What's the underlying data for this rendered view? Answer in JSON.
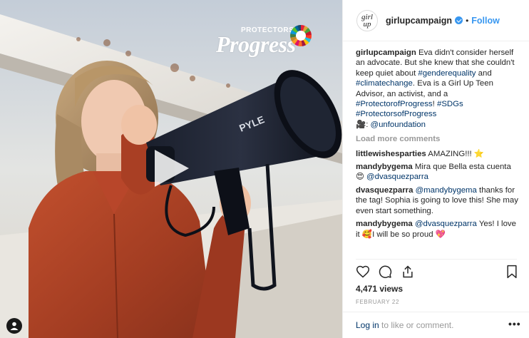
{
  "media": {
    "overlay_logo_small": "PROTECTORS",
    "overlay_logo_of": "of",
    "overlay_logo_big": "Progress",
    "megaphone_brand": "PYLE"
  },
  "post": {
    "avatar_text": "girl up",
    "username": "girlupcampaign",
    "dot": "•",
    "follow_label": "Follow"
  },
  "caption": {
    "username": "girlupcampaign",
    "text_1": " Eva didn't consider herself an advocate. But she knew that she couldn't keep quiet about ",
    "tag_1": "#genderequality",
    "text_2": " and ",
    "tag_2": "#climatechange",
    "text_3": ". Eva is a Girl Up Teen Advisor, an activist, and a ",
    "tag_3": "#ProtectorofProgress",
    "text_4": "! ",
    "tag_4": "#SDGs",
    "tag_5": "#ProtectorsofProgress",
    "credit_emoji": "🎥",
    "credit_sep": ": ",
    "credit_tag": "@unfoundation"
  },
  "load_more_label": "Load more comments",
  "comments": [
    {
      "username": "littlewishesparties",
      "text": " AMAZING!!! ",
      "emoji": "⭐"
    },
    {
      "username": "mandybygema",
      "text": " Mira que Bella esta cuenta",
      "emoji": "😍",
      "mention": "@dvasquezparra"
    },
    {
      "username": "dvasquezparra",
      "mention": "@mandybygema",
      "text": " thanks for the tag! Sophia is going to love this! She may even start something."
    },
    {
      "username": "mandybygema",
      "mention": "@dvasquezparra",
      "text": " Yes! I love it ",
      "emoji": "🥰",
      "text_2": "I will be so proud ",
      "emoji_2": "💖"
    }
  ],
  "views": "4,471 views",
  "date": "FEBRUARY 22",
  "login": {
    "link": "Log in",
    "text": " to like or comment."
  },
  "more_label": "•••",
  "icons": [
    "heart-icon",
    "comment-icon",
    "share-icon",
    "bookmark-icon",
    "play-icon",
    "user-tag-icon",
    "more-options-icon"
  ],
  "colors": {
    "link": "#3897f0",
    "tag": "#003569",
    "muted": "#999999"
  }
}
